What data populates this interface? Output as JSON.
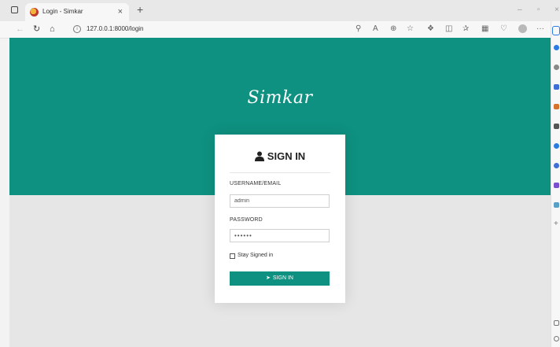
{
  "browser": {
    "tab_title": "Login - Simkar",
    "tab_close": "×",
    "new_tab": "+",
    "win_minimize": "–",
    "win_restore": "▫",
    "win_close": "×",
    "url": "127.0.0.1:8000/login",
    "toolbar_more": "···",
    "accent": "#2a7be4"
  },
  "page": {
    "brand": "Simkar",
    "accent_color": "#0e9180",
    "login": {
      "title": "SIGN IN",
      "username_label": "USERNAME/EMAIL",
      "username_value": "admin",
      "password_label": "PASSWORD",
      "password_value": "••••••",
      "remember_label": "Stay Signed in",
      "remember_checked": false,
      "submit_label": "SIGN IN"
    }
  },
  "icons": {
    "user": "user-icon",
    "signin": "signin-icon"
  }
}
